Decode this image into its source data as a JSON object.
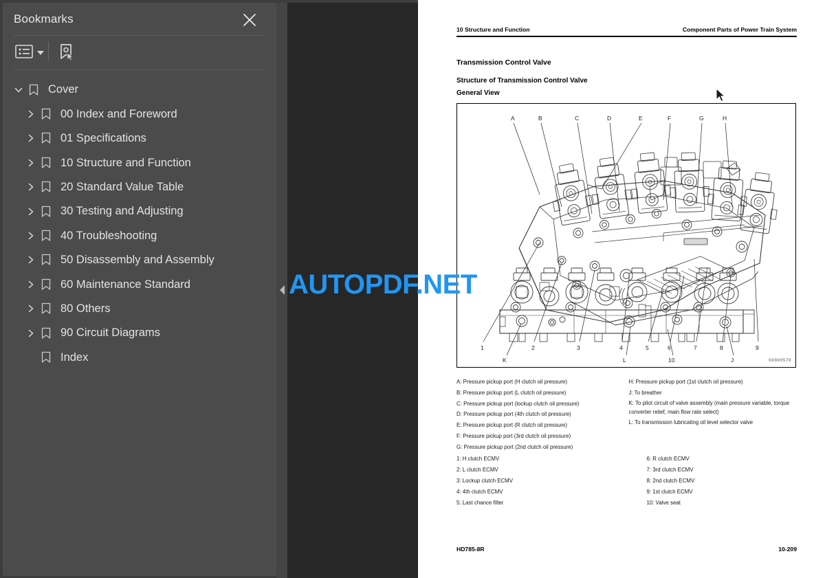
{
  "sidebar": {
    "title": "Bookmarks",
    "close_icon": "close-icon",
    "toolbar": {
      "options_label": "bookmark-options",
      "options_icon": "list-options-icon",
      "find_icon": "select-bookmark-icon"
    },
    "items": [
      {
        "label": "Cover",
        "level": 0,
        "expanded": true,
        "has_children": true
      },
      {
        "label": "00 Index and Foreword",
        "level": 1,
        "expanded": false,
        "has_children": true
      },
      {
        "label": "01 Specifications",
        "level": 1,
        "expanded": false,
        "has_children": true
      },
      {
        "label": "10 Structure and Function",
        "level": 1,
        "expanded": false,
        "has_children": true
      },
      {
        "label": "20 Standard Value Table",
        "level": 1,
        "expanded": false,
        "has_children": true
      },
      {
        "label": "30 Testing and Adjusting",
        "level": 1,
        "expanded": false,
        "has_children": true
      },
      {
        "label": "40 Troubleshooting",
        "level": 1,
        "expanded": false,
        "has_children": true
      },
      {
        "label": "50 Disassembly and Assembly",
        "level": 1,
        "expanded": false,
        "has_children": true
      },
      {
        "label": "60 Maintenance Standard",
        "level": 1,
        "expanded": false,
        "has_children": true
      },
      {
        "label": "80 Others",
        "level": 1,
        "expanded": false,
        "has_children": true
      },
      {
        "label": "90 Circuit Diagrams",
        "level": 1,
        "expanded": false,
        "has_children": true
      },
      {
        "label": "Index",
        "level": 1,
        "expanded": false,
        "has_children": false
      }
    ]
  },
  "viewer": {
    "collapse_handle_icon": "triangle-left-icon",
    "watermark": "AUTOPDF.NET",
    "watermark_color": "#2196f3"
  },
  "page": {
    "header_left": "10 Structure and Function",
    "header_right": "Component Parts of Power Train System",
    "title": "Transmission Control Valve",
    "subtitle": "Structure of Transmission Control Valve",
    "subtitle2": "General View",
    "drawing_number": "G0009570",
    "legend_left": [
      "A: Pressure pickup port (H clutch oil pressure)",
      "B: Pressure pickup port (L clutch oil pressure)",
      "C: Pressure pickup port (lockup clutch oil pressure)",
      "D: Pressure pickup port (4th clutch oil pressure)",
      "E: Pressure pickup port (R clutch oil pressure)",
      "F: Pressure pickup port (3rd clutch oil pressure)",
      "G: Pressure pickup port (2nd clutch oil pressure)"
    ],
    "legend_right": [
      "H: Pressure pickup port (1st clutch oil pressure)",
      "J: To breather",
      "K:  To  pilot  circuit  of  valve  assembly  (main  pressure variable,  torque  converter  relief,  main  flow  rate  select)",
      "L: To transmission lubricating oil level selector valve"
    ],
    "numbers_left": [
      "1: H clutch ECMV",
      "2: L clutch ECMV",
      "3: Lockup clutch ECMV",
      "4: 4th clutch ECMV",
      "5: Last chance filter"
    ],
    "numbers_right": [
      "6: R clutch ECMV",
      "7: 3rd clutch ECMV",
      "8: 2nd clutch ECMV",
      "9: 1st clutch ECMV",
      "10: Valve seat"
    ],
    "figure_callouts_top_letters": [
      "A",
      "B",
      "C",
      "D",
      "E",
      "F",
      "G",
      "H"
    ],
    "figure_callouts_top_numbers": [
      "1",
      "2",
      "3",
      "4",
      "5",
      "6",
      "7",
      "8",
      "9"
    ],
    "figure_callouts_bottom": [
      "K",
      "L",
      "10",
      "J"
    ],
    "footer_left": "HD785-8R",
    "footer_right": "10-209"
  }
}
